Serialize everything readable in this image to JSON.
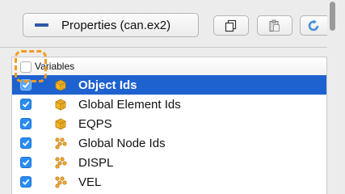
{
  "toolbar": {
    "properties_label": "Properties (can.ex2)",
    "copy_icon": "copy-icon",
    "paste_icon": "paste-icon",
    "refresh_icon": "refresh-icon"
  },
  "variables": {
    "header_label": "Variables",
    "header_checked": false,
    "items": [
      {
        "label": "Object Ids",
        "icon": "cell-data-icon",
        "checked": true,
        "selected": true
      },
      {
        "label": "Global Element Ids",
        "icon": "cell-data-icon",
        "checked": true,
        "selected": false
      },
      {
        "label": "EQPS",
        "icon": "cell-data-icon",
        "checked": true,
        "selected": false
      },
      {
        "label": "Global Node Ids",
        "icon": "point-data-icon",
        "checked": true,
        "selected": false
      },
      {
        "label": "DISPL",
        "icon": "point-data-icon",
        "checked": true,
        "selected": false
      },
      {
        "label": "VEL",
        "icon": "point-data-icon",
        "checked": true,
        "selected": false
      }
    ]
  },
  "colors": {
    "selection": "#1e62d0",
    "checkbox": "#2a8cf2",
    "highlight": "#f59a1e",
    "cell_icon": "#e0a21a",
    "point_icon": "#e8a020"
  }
}
